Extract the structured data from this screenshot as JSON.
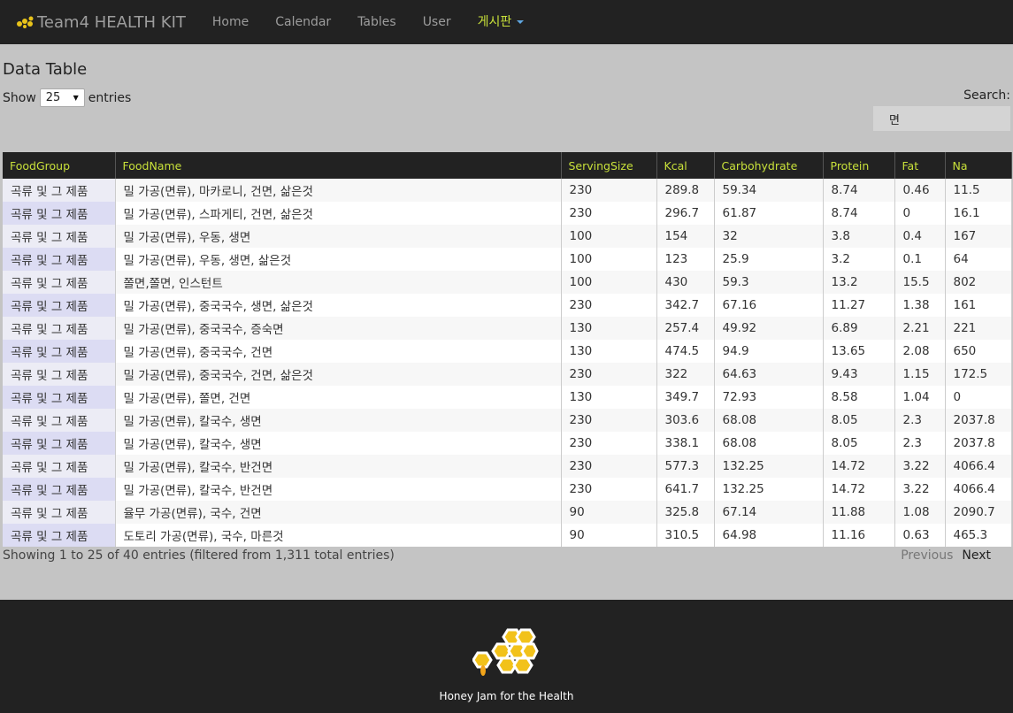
{
  "navbar": {
    "brand": "Team4 HEALTH KIT",
    "links": [
      "Home",
      "Calendar",
      "Tables",
      "User"
    ],
    "dropdown_label": "게시판"
  },
  "page": {
    "title": "Data Table",
    "show_label": "Show",
    "entries_value": "25",
    "entries_label": "entries",
    "search_label": "Search:",
    "search_value": "면"
  },
  "table": {
    "headers": [
      "FoodGroup",
      "FoodName",
      "ServingSize",
      "Kcal",
      "Carbohydrate",
      "Protein",
      "Fat",
      "Na"
    ],
    "rows": [
      [
        "곡류 및 그 제품",
        "밀 가공(면류), 마카로니, 건면, 삶은것",
        "230",
        "289.8",
        "59.34",
        "8.74",
        "0.46",
        "11.5"
      ],
      [
        "곡류 및 그 제품",
        "밀 가공(면류), 스파게티, 건면, 삶은것",
        "230",
        "296.7",
        "61.87",
        "8.74",
        "0",
        "16.1"
      ],
      [
        "곡류 및 그 제품",
        "밀 가공(면류), 우동, 생면",
        "100",
        "154",
        "32",
        "3.8",
        "0.4",
        "167"
      ],
      [
        "곡류 및 그 제품",
        "밀 가공(면류), 우동, 생면, 삶은것",
        "100",
        "123",
        "25.9",
        "3.2",
        "0.1",
        "64"
      ],
      [
        "곡류 및 그 제품",
        "쫄면,쫄면, 인스턴트",
        "100",
        "430",
        "59.3",
        "13.2",
        "15.5",
        "802"
      ],
      [
        "곡류 및 그 제품",
        "밀 가공(면류), 중국국수, 생면, 삶은것",
        "230",
        "342.7",
        "67.16",
        "11.27",
        "1.38",
        "161"
      ],
      [
        "곡류 및 그 제품",
        "밀 가공(면류), 중국국수, 증숙면",
        "130",
        "257.4",
        "49.92",
        "6.89",
        "2.21",
        "221"
      ],
      [
        "곡류 및 그 제품",
        "밀 가공(면류), 중국국수, 건면",
        "130",
        "474.5",
        "94.9",
        "13.65",
        "2.08",
        "650"
      ],
      [
        "곡류 및 그 제품",
        "밀 가공(면류), 중국국수, 건면, 삶은것",
        "230",
        "322",
        "64.63",
        "9.43",
        "1.15",
        "172.5"
      ],
      [
        "곡류 및 그 제품",
        "밀 가공(면류), 쫄면, 건면",
        "130",
        "349.7",
        "72.93",
        "8.58",
        "1.04",
        "0"
      ],
      [
        "곡류 및 그 제품",
        "밀 가공(면류), 칼국수, 생면",
        "230",
        "303.6",
        "68.08",
        "8.05",
        "2.3",
        "2037.8"
      ],
      [
        "곡류 및 그 제품",
        "밀 가공(면류), 칼국수, 생면",
        "230",
        "338.1",
        "68.08",
        "8.05",
        "2.3",
        "2037.8"
      ],
      [
        "곡류 및 그 제품",
        "밀 가공(면류), 칼국수, 반건면",
        "230",
        "577.3",
        "132.25",
        "14.72",
        "3.22",
        "4066.4"
      ],
      [
        "곡류 및 그 제품",
        "밀 가공(면류), 칼국수, 반건면",
        "230",
        "641.7",
        "132.25",
        "14.72",
        "3.22",
        "4066.4"
      ],
      [
        "곡류 및 그 제품",
        "율무 가공(면류), 국수, 건면",
        "90",
        "325.8",
        "67.14",
        "11.88",
        "1.08",
        "2090.7"
      ],
      [
        "곡류 및 그 제품",
        "도토리 가공(면류), 국수, 마른것",
        "90",
        "310.5",
        "64.98",
        "11.16",
        "0.63",
        "465.3"
      ]
    ]
  },
  "footer_info": {
    "showing": "Showing 1 to 25 of 40 entries (filtered from 1,311 total entries)",
    "previous": "Previous",
    "next": "Next"
  },
  "footer": {
    "tagline": "Honey Jam for the Health"
  }
}
